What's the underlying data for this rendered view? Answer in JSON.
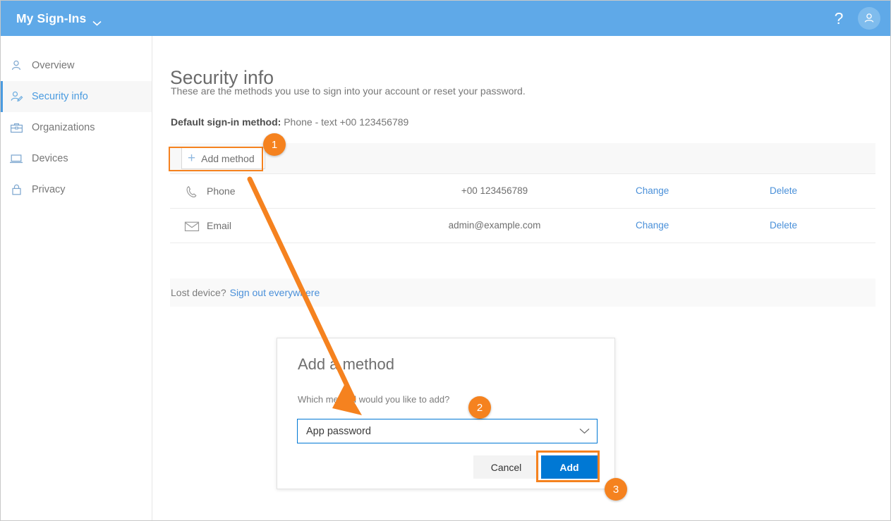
{
  "window": {
    "title": "My Sign-Ins",
    "help_icon": "question-mark-icon",
    "avatar_icon": "person-icon",
    "brand_chevron": "chevron-down-icon",
    "header_color": "#5FA9E8"
  },
  "sidebar": {
    "items": [
      {
        "label": "Overview",
        "icon": "person-icon",
        "active": false
      },
      {
        "label": "Security info",
        "icon": "person-edit-icon",
        "active": true
      },
      {
        "label": "Organizations",
        "icon": "briefcase-icon",
        "active": false
      },
      {
        "label": "Devices",
        "icon": "laptop-icon",
        "active": false
      },
      {
        "label": "Privacy",
        "icon": "lock-icon",
        "active": false
      }
    ],
    "accent_color": "#4A9BE0"
  },
  "main": {
    "title": "Security info",
    "subtitle": "These are the methods you use to sign into your account or reset your password.",
    "default_method_label": "Default sign-in method:",
    "default_method_value": "Phone - text +00 123456789",
    "add_method_button": "Add method",
    "add_method_icon": "plus-icon",
    "table": {
      "rows": [
        {
          "icon": "phone-icon",
          "name": "Phone",
          "value": "+00 123456789",
          "change": "Change",
          "delete": "Delete"
        },
        {
          "icon": "envelope-icon",
          "name": "Email",
          "value": "admin@example.com",
          "change": "Change",
          "delete": "Delete"
        }
      ]
    },
    "lost_device_text": "Lost device?",
    "lost_device_link": "Sign out everywhere"
  },
  "modal": {
    "title": "Add a method",
    "question": "Which method would you like to add?",
    "select_value": "App password",
    "select_chevron": "chevron-down-icon",
    "cancel_label": "Cancel",
    "add_label": "Add",
    "add_color": "#0078D4"
  },
  "annotations": {
    "badge_1": "1",
    "badge_2": "2",
    "badge_3": "3",
    "highlight_color": "#F5821F",
    "arrow": "orange-arrow-pointing-to-dropdown"
  }
}
